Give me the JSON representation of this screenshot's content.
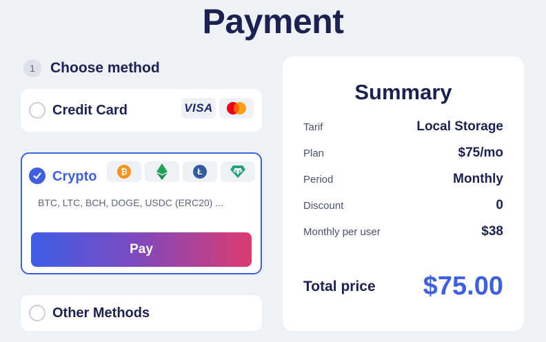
{
  "page": {
    "title": "Payment"
  },
  "step": {
    "number": "1",
    "label": "Choose method"
  },
  "methods": {
    "credit_card": {
      "label": "Credit Card",
      "selected": false,
      "brands": [
        "VISA",
        "mastercard-icon"
      ]
    },
    "crypto": {
      "label": "Crypto",
      "selected": true,
      "coins": [
        "bitcoin-icon",
        "ethereum-icon",
        "litecoin-icon",
        "tether-icon"
      ],
      "supported": "BTC, LTC, BCH, DOGE, USDC (ERC20) ...",
      "pay_label": "Pay"
    },
    "other": {
      "label": "Other Methods",
      "selected": false
    }
  },
  "summary": {
    "title": "Summary",
    "rows": [
      {
        "label": "Tarif",
        "value": "Local Storage"
      },
      {
        "label": "Plan",
        "value": "$75/mo"
      },
      {
        "label": "Period",
        "value": "Monthly"
      },
      {
        "label": "Discount",
        "value": "0"
      },
      {
        "label": "Monthly per user",
        "value": "$38"
      }
    ],
    "total_label": "Total price",
    "total_value": "$75.00"
  },
  "colors": {
    "accent": "#3d5fe0",
    "text": "#1b2150",
    "background": "#eef1f6",
    "gradient_start": "#3d5fe6",
    "gradient_end": "#dc3b6f",
    "bitcoin": "#f7931a",
    "ethereum": "#1fa55a",
    "litecoin": "#345d9d",
    "tether": "#26a17b"
  }
}
